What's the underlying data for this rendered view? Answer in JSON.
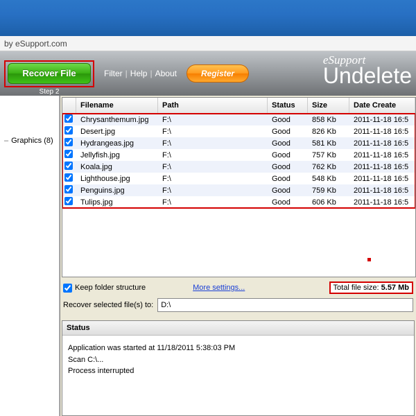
{
  "subbar_text": "by eSupport.com",
  "toolbar": {
    "recover_label": "Recover File",
    "step_label": "Step 2",
    "menu": {
      "filter": "Filter",
      "help": "Help",
      "about": "About"
    },
    "register_label": "Register"
  },
  "brand": {
    "line1": "eSupport",
    "line2": "Undelete"
  },
  "sidebar": {
    "item_label": "Graphics (8)"
  },
  "grid": {
    "headers": {
      "filename": "Filename",
      "path": "Path",
      "status": "Status",
      "size": "Size",
      "date": "Date Create"
    },
    "rows": [
      {
        "checked": true,
        "name": "Chrysanthemum.jpg",
        "path": "F:\\",
        "status": "Good",
        "size": "858 Kb",
        "date": "2011-11-18 16:5"
      },
      {
        "checked": true,
        "name": "Desert.jpg",
        "path": "F:\\",
        "status": "Good",
        "size": "826 Kb",
        "date": "2011-11-18 16:5"
      },
      {
        "checked": true,
        "name": "Hydrangeas.jpg",
        "path": "F:\\",
        "status": "Good",
        "size": "581 Kb",
        "date": "2011-11-18 16:5"
      },
      {
        "checked": true,
        "name": "Jellyfish.jpg",
        "path": "F:\\",
        "status": "Good",
        "size": "757 Kb",
        "date": "2011-11-18 16:5"
      },
      {
        "checked": true,
        "name": "Koala.jpg",
        "path": "F:\\",
        "status": "Good",
        "size": "762 Kb",
        "date": "2011-11-18 16:5"
      },
      {
        "checked": true,
        "name": "Lighthouse.jpg",
        "path": "F:\\",
        "status": "Good",
        "size": "548 Kb",
        "date": "2011-11-18 16:5"
      },
      {
        "checked": true,
        "name": "Penguins.jpg",
        "path": "F:\\",
        "status": "Good",
        "size": "759 Kb",
        "date": "2011-11-18 16:5"
      },
      {
        "checked": true,
        "name": "Tulips.jpg",
        "path": "F:\\",
        "status": "Good",
        "size": "606 Kb",
        "date": "2011-11-18 16:5"
      }
    ]
  },
  "settings": {
    "keep_label": "Keep folder structure",
    "more_label": "More settings...",
    "total_prefix": "Total file size: ",
    "total_value": "5.57 Mb",
    "recover_to_label": "Recover selected file(s) to:",
    "recover_to_value": "D:\\"
  },
  "status": {
    "header": "Status",
    "line1": "Application was started at 11/18/2011 5:38:03 PM",
    "line2": "Scan C:\\...",
    "line3": "Process interrupted"
  }
}
